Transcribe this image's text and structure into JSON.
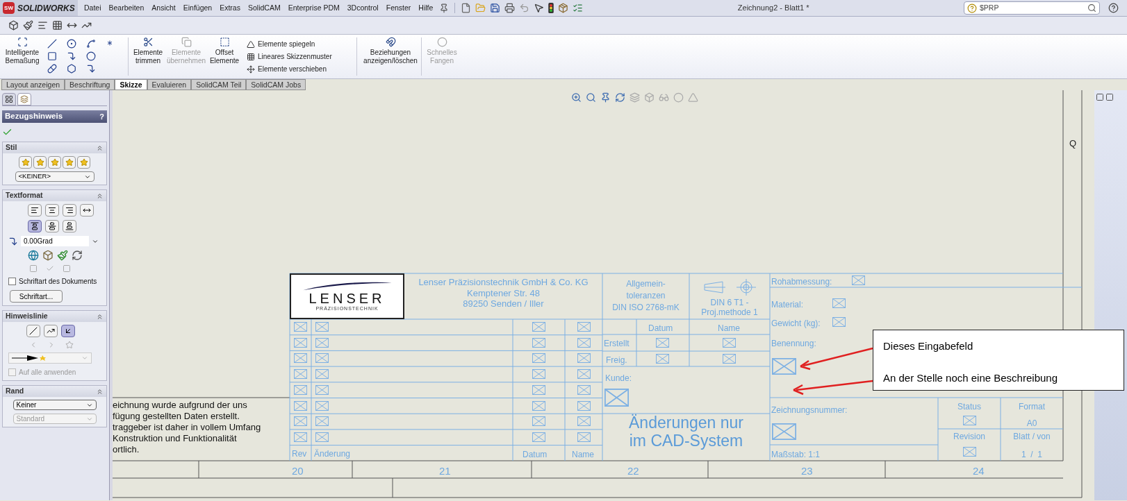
{
  "app": {
    "logo_mark": "SW",
    "logo": "SOLIDWORKS",
    "menu": [
      "Datei",
      "Bearbeiten",
      "Ansicht",
      "Einfügen",
      "Extras",
      "SolidCAM",
      "Enterprise PDM",
      "3Dcontrol",
      "Fenster",
      "Hilfe"
    ],
    "title": "Zeichnung2 - Blatt1 *",
    "search": {
      "value": "$PRP"
    }
  },
  "ribbon": {
    "dimension": {
      "lines": [
        "Intelligente",
        "Bemaßung"
      ],
      "disabled": false
    },
    "edit_tools": [
      {
        "lines": [
          "Elemente",
          "trimmen"
        ],
        "disabled": false
      },
      {
        "lines": [
          "Elemente",
          "übernehmen"
        ],
        "disabled": true
      },
      {
        "lines": [
          "Offset",
          "Elemente"
        ],
        "disabled": false
      }
    ],
    "edit_list": [
      "Elemente spiegeln",
      "Lineares Skizzenmuster",
      "Elemente verschieben"
    ],
    "relations": {
      "lines": [
        "Beziehungen",
        "anzeigen/löschen"
      ],
      "disabled": false
    },
    "snap": {
      "lines": [
        "Schnelles",
        "Fangen"
      ],
      "disabled": true
    }
  },
  "tabs": [
    {
      "label": "Layout anzeigen",
      "selected": false
    },
    {
      "label": "Beschriftung",
      "selected": false
    },
    {
      "label": "Skizze",
      "selected": true
    },
    {
      "label": "Evaluieren",
      "selected": false
    },
    {
      "label": "SolidCAM Teil",
      "selected": false
    },
    {
      "label": "SolidCAM Jobs",
      "selected": false
    }
  ],
  "property_manager": {
    "view_tabs": [
      {
        "selected": false
      },
      {
        "selected": true
      }
    ],
    "title": "Bezugshinweis",
    "help": "?",
    "style": {
      "heading": "Stil",
      "value": "<KEINER>"
    },
    "text_format": {
      "heading": "Textformat",
      "halign": [
        {
          "pressed": false
        },
        {
          "pressed": false
        },
        {
          "pressed": false
        },
        {
          "pressed": false
        }
      ],
      "valign": [
        {
          "pressed": true
        },
        {
          "pressed": false
        },
        {
          "pressed": false
        }
      ],
      "angle": "0.00Grad",
      "document_font": {
        "label": "Schriftart des Dokuments",
        "checked": false
      },
      "font_button": "Schriftart..."
    },
    "leader": {
      "heading": "Hinweislinie",
      "styles": [
        {
          "pressed": false
        },
        {
          "pressed": false
        },
        {
          "pressed": true
        }
      ],
      "apply_all": {
        "label": "Auf alle anwenden",
        "checked": false,
        "disabled": true
      }
    },
    "border": {
      "heading": "Rand",
      "style": "Keiner",
      "size": "Standard"
    }
  },
  "drawing": {
    "note_lines": [
      "eichnung wurde aufgrund der uns",
      "fügung gestellten Daten erstellt.",
      "traggeber ist daher in vollem Umfang",
      "Konstruktion und Funktionalität",
      "ortlich."
    ],
    "logo": "LENSER",
    "logo_sub": "PRÄZISIONSTECHNIK",
    "company": [
      "Lenser Präzisionstechnik GmbH & Co. KG",
      "Kemptener Str. 48",
      "89250 Senden / Iller"
    ],
    "tolerances": [
      "Allgemein-",
      "toleranzen",
      "DIN ISO 2768-mK"
    ],
    "projection": [
      "DIN 6  T1 -",
      "Proj.methode 1"
    ],
    "revision_headers": [
      "Rev",
      "Änderung",
      "Datum",
      "Name"
    ],
    "approval_headers": [
      "Datum",
      "Name"
    ],
    "approval_rows": [
      "Erstellt",
      "Freig."
    ],
    "customer": "Kunde:",
    "cad_notice": [
      "Änderungen nur",
      "im CAD-System"
    ],
    "raw_size": "Rohabmessung:",
    "material": "Material:",
    "weight": "Gewicht (kg):",
    "designation": "Benennung:",
    "drawing_number": "Zeichnungsnummer:",
    "scale": "Maßstab:  1:1",
    "status": "Status",
    "format": "Format",
    "format_value": "A0",
    "revision": "Revision",
    "sheet": "Blatt / von",
    "sheet_value": "1  /  1",
    "zones": [
      "20",
      "21",
      "22",
      "23",
      "24"
    ],
    "frame_marker": "Q"
  },
  "callout": {
    "lines": [
      "Dieses Eingabefeld",
      "An der Stelle noch eine Beschreibung"
    ]
  }
}
